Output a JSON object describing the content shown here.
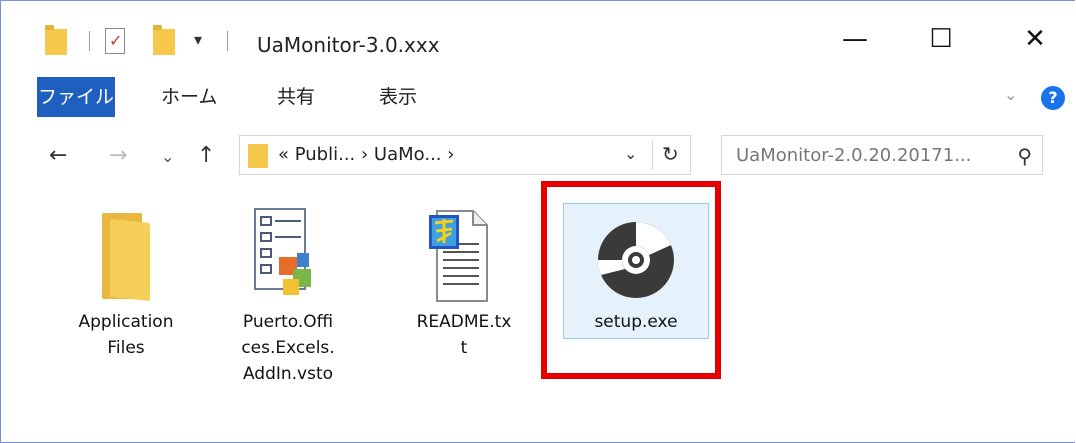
{
  "window": {
    "title": "UaMonitor-3.0.xxx",
    "controls": {
      "minimize": "—",
      "maximize": "☐",
      "close": "✕"
    },
    "qa_dropdown": "▾"
  },
  "ribbon": {
    "tabs": [
      "ファイル",
      "ホーム",
      "共有",
      "表示"
    ],
    "expand": "⌄",
    "help": "?"
  },
  "nav": {
    "back": "←",
    "forward": "→",
    "recent": "⌄",
    "up": "↑"
  },
  "address": {
    "path_text": "« Publi... › UaMo... ›",
    "dropdown": "⌄",
    "refresh": "↻"
  },
  "search": {
    "placeholder": "UaMonitor-2.0.20.20171...",
    "icon": "⚲"
  },
  "files": [
    {
      "name": "Application Files",
      "lines": [
        "Application",
        "Files"
      ]
    },
    {
      "name": "Puerto.Offices.Excels.AddIn.vsto",
      "lines": [
        "Puerto.Offi",
        "ces.Excels.",
        "AddIn.vsto"
      ]
    },
    {
      "name": "README.txt",
      "lines": [
        "README.tx",
        "t"
      ]
    },
    {
      "name": "setup.exe",
      "lines": [
        "setup.exe"
      ]
    }
  ],
  "colors": {
    "file_tab": "#1f5fbf",
    "highlight": "#e60000",
    "selection": "#e5f1fb"
  }
}
